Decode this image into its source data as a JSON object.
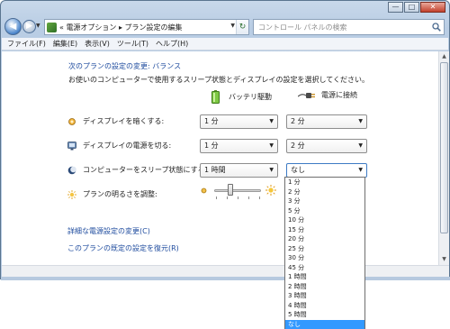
{
  "window": {
    "caption_buttons": {
      "minimize": "—",
      "maximize": "□",
      "close": "✕"
    }
  },
  "nav": {
    "back_glyph": "◀",
    "forward_glyph": "▶",
    "dropdown_glyph": "▼",
    "refresh_glyph": "↻"
  },
  "address": {
    "breadcrumb": "« 電源オプション ▸ プラン設定の編集"
  },
  "search": {
    "placeholder": "コントロール パネルの検索"
  },
  "menubar": {
    "items": [
      "ファイル(F)",
      "編集(E)",
      "表示(V)",
      "ツール(T)",
      "ヘルプ(H)"
    ]
  },
  "page": {
    "heading": "次のプランの設定の変更: バランス",
    "description": "お使いのコンピューターで使用するスリープ状態とディスプレイの設定を選択してください。",
    "column_battery": "バッテリ駆動",
    "column_plugged": "電源に接続"
  },
  "settings": {
    "dim_display": {
      "label": "ディスプレイを暗くする:",
      "battery": "1 分",
      "plugged": "2 分"
    },
    "turn_off_display": {
      "label": "ディスプレイの電源を切る:",
      "battery": "1 分",
      "plugged": "2 分"
    },
    "sleep": {
      "label": "コンピューターをスリープ状態にする:",
      "battery": "1 時間",
      "plugged": "なし"
    },
    "brightness": {
      "label": "プランの明るさを調整:",
      "level": 0.3
    }
  },
  "links": {
    "advanced": "詳細な電源設定の変更(C)",
    "restore": "このプランの既定の設定を復元(R)"
  },
  "sleep_dropdown": {
    "options": [
      "1 分",
      "2 分",
      "3 分",
      "5 分",
      "10 分",
      "15 分",
      "20 分",
      "25 分",
      "30 分",
      "45 分",
      "1 時間",
      "2 時間",
      "3 時間",
      "4 時間",
      "5 時間",
      "なし"
    ],
    "selected": "なし"
  },
  "colors": {
    "link": "#1e4b9e",
    "selection": "#3399ff",
    "chrome": "#b9cde4"
  }
}
